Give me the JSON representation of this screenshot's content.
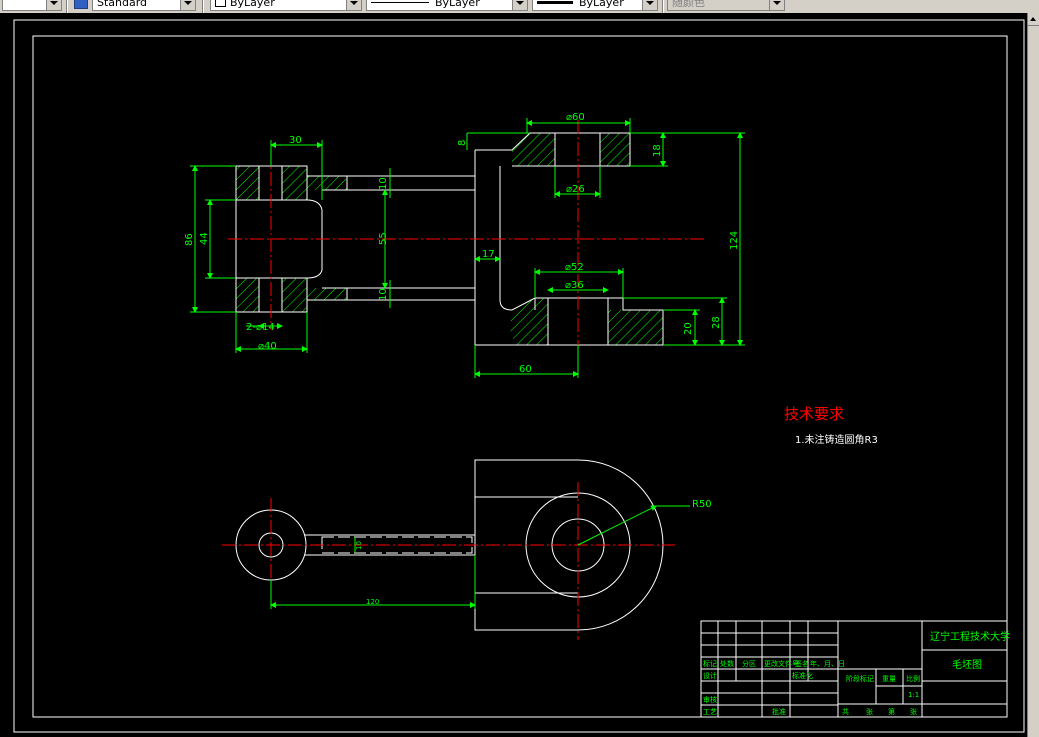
{
  "toolbar": {
    "text_style": "Standard",
    "layer_color": "ByLayer",
    "linetype": "ByLayer",
    "lineweight": "ByLayer",
    "plot_style": "随颜色"
  },
  "dimensions": {
    "d30": "30",
    "d8": "8",
    "d60_dia": "⌀60",
    "d18": "18",
    "d26_dia": "⌀26",
    "d124": "124",
    "d86": "86",
    "d44": "44",
    "d55": "55",
    "d10_top": "10",
    "d10_bot": "10",
    "d17": "17",
    "d52_dia": "⌀52",
    "d36_dia": "⌀36",
    "d2x14": "2-⌀14",
    "d40_dia": "⌀40",
    "d60": "60",
    "d20": "20",
    "d28": "28",
    "d120": "120",
    "r50": "R50",
    "d10_side": "10"
  },
  "notes": {
    "title": "技术要求",
    "item1": "1.未注铸造圆角R3"
  },
  "title_block": {
    "university": "辽宁工程技术大学",
    "drawing_name": "毛坯图",
    "row_labels": [
      "标记",
      "处数",
      "分区",
      "更改文件号",
      "签名",
      "年、月、日"
    ],
    "design": "设计",
    "stamp_label": "标准化",
    "review": "审核",
    "process": "工艺",
    "approve": "批准",
    "stage_mark": "阶段标记",
    "weight": "重量",
    "scale": "比例",
    "scale_value": "1:1",
    "sheets": [
      "共",
      "张",
      "第",
      "张"
    ]
  },
  "colors": {
    "background": "#000000",
    "geometry": "#ffffff",
    "dimension": "#00ff00",
    "centerline": "#ff0000",
    "hatch": "#00ff00",
    "title_block_text": "#00ff00"
  }
}
